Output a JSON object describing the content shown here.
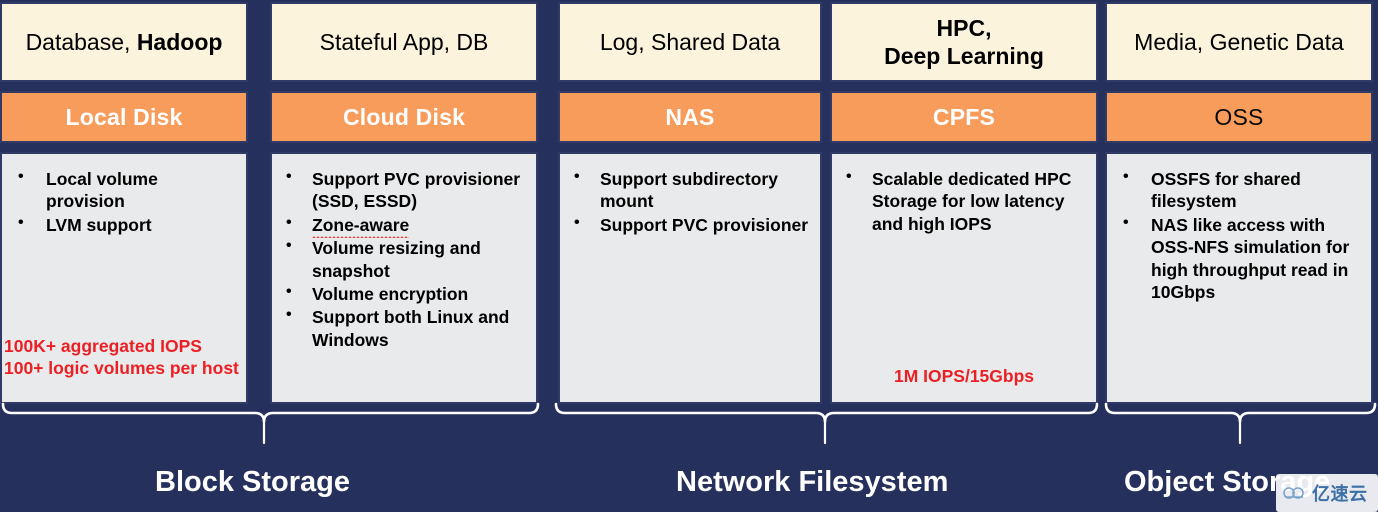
{
  "slide": {
    "background_color": "#26305c",
    "usecase_color": "#fcf3dd",
    "product_color": "#f89c5c",
    "feature_color": "#e9eaec",
    "metric_color": "#ec2024"
  },
  "columns": [
    {
      "usecase_plain": "Database, ",
      "usecase_bold": "Hadoop",
      "product": "Local Disk",
      "bullets": [
        "Local volume provision",
        "LVM support"
      ],
      "metrics": [
        "100K+ aggregated IOPS",
        "100+ logic volumes per host"
      ]
    },
    {
      "usecase_plain": "Stateful App, DB",
      "usecase_bold": "",
      "product": "Cloud Disk",
      "bullets": [
        "Support PVC provisioner (SSD, ESSD)",
        "Zone-aware",
        "Volume resizing and snapshot",
        "Volume encryption",
        "Support both Linux and Windows"
      ],
      "metrics": []
    },
    {
      "usecase_plain": "Log, Shared Data",
      "usecase_bold": "",
      "product": "NAS",
      "bullets": [
        "Support subdirectory mount",
        "Support PVC provisioner"
      ],
      "metrics": []
    },
    {
      "usecase_line1": "HPC,",
      "usecase_line2": "Deep Learning",
      "product": "CPFS",
      "bullets": [
        "Scalable dedicated HPC Storage for low latency and high IOPS"
      ],
      "metrics": [
        "1M IOPS/15Gbps"
      ]
    },
    {
      "usecase_plain": "Media, Genetic Data",
      "usecase_bold": "",
      "product": "OSS",
      "bullets": [
        "OSSFS for shared filesystem",
        "NAS like access with OSS-NFS simulation for high throughput read in 10Gbps"
      ],
      "metrics": []
    }
  ],
  "categories": [
    {
      "label": "Block Storage"
    },
    {
      "label": "Network Filesystem"
    },
    {
      "label": "Object Storage"
    }
  ],
  "watermark": {
    "text": "亿速云",
    "icon": "cloud-icon"
  }
}
